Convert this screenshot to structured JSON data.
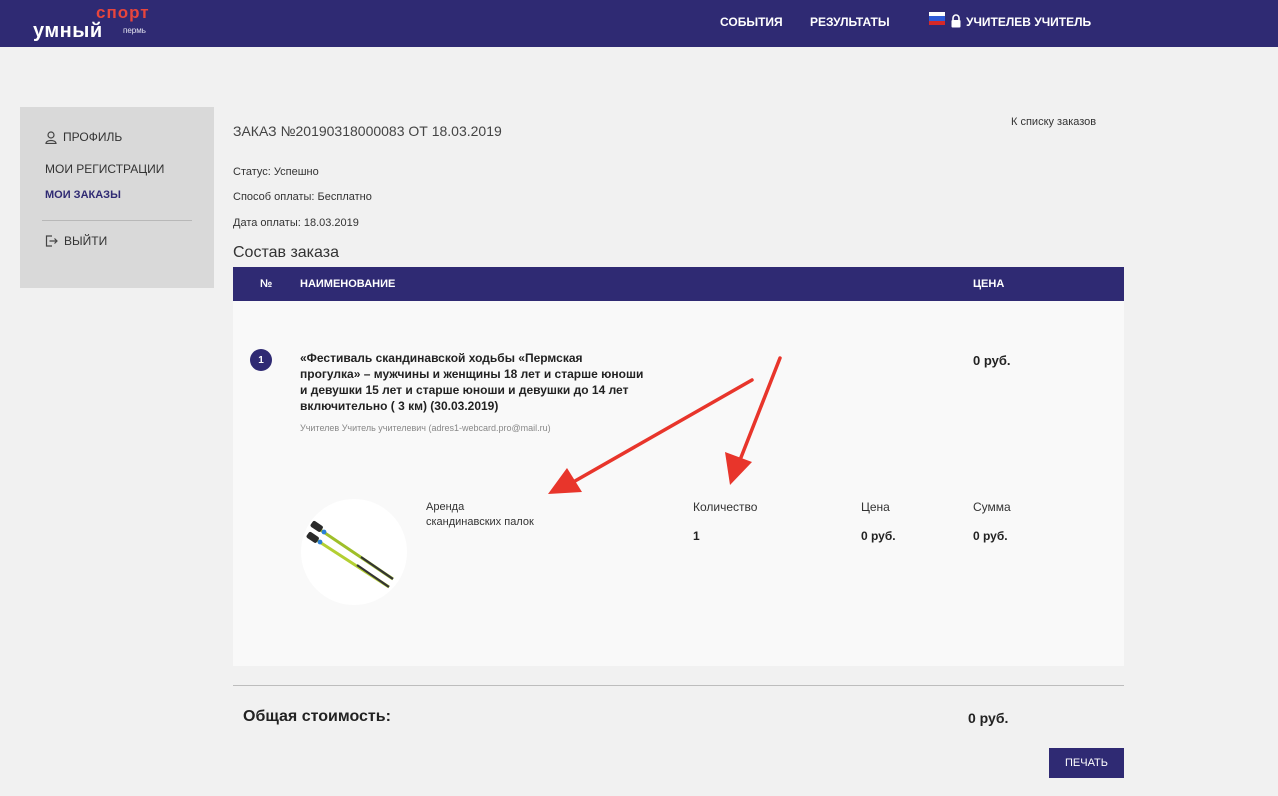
{
  "header": {
    "logo": {
      "main": "умный",
      "sport": "спорт",
      "city": "пермь"
    },
    "nav": {
      "events": "СОБЫТИЯ",
      "results": "РЕЗУЛЬТАТЫ"
    },
    "user_name": "УЧИТЕЛЕВ УЧИТЕЛЬ",
    "brand_color": "#2f2a73",
    "logo_accent_color": "#e8453c"
  },
  "sidebar": {
    "profile": "ПРОФИЛЬ",
    "registrations": "МОИ РЕГИСТРАЦИИ",
    "orders": "МОИ ЗАКАЗЫ",
    "logout": "ВЫЙТИ",
    "active_color": "#2f2a73"
  },
  "order": {
    "title": "ЗАКАЗ №20190318000083 ОТ 18.03.2019",
    "back_link": "К списку заказов",
    "status": "Статус: Успешно",
    "payment_method": "Способ оплаты: Бесплатно",
    "payment_date": "Дата оплаты: 18.03.2019",
    "section_title": "Состав заказа"
  },
  "table": {
    "col_number": "№",
    "col_name": "НАИМЕНОВАНИЕ",
    "col_price": "ЦЕНА"
  },
  "item": {
    "number": "1",
    "name": "«Фестиваль скандинавской ходьбы «Пермская прогулка» – мужчины и женщины 18 лет и старше юноши и девушки 15 лет и старше юноши и девушки до 14 лет включительно ( 3 км) (30.03.2019)",
    "participant": "Учителев Учитель учителевич (adres1-webcard.pro@mail.ru)",
    "price": "0 руб."
  },
  "addon": {
    "name_line1": "Аренда",
    "name_line2": "скандинавских палок",
    "quantity_label": "Количество",
    "quantity_value": "1",
    "price_label": "Цена",
    "price_value": "0 руб.",
    "sum_label": "Сумма",
    "sum_value": "0 руб.",
    "icon": "nordic-walking-poles"
  },
  "total": {
    "label": "Общая стоимость:",
    "value": "0 руб."
  },
  "print_button": "ПЕЧАТЬ",
  "annotation_color": "#e8352b"
}
